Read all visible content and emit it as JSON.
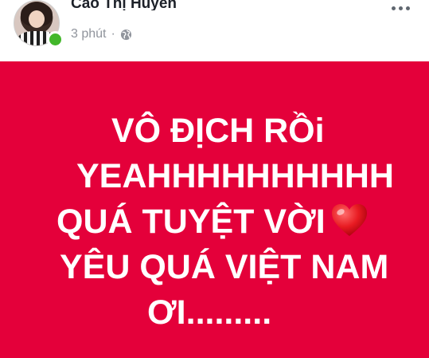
{
  "post": {
    "author": "Cao Thị Huyền",
    "timestamp": "3 phút",
    "separator": "·",
    "privacy_icon": "globe-icon",
    "more_icon": "more-options-icon",
    "online_status_color": "#42b72a"
  },
  "card": {
    "background": "#e4003a",
    "text_color": "#ffffff",
    "lines": [
      "VÔ ĐỊCH RỒi",
      "YEAHHHHHHHHHH",
      "QUÁ TUYỆT VỜI",
      "YÊU QUÁ VIỆT NAM",
      "ƠI........."
    ],
    "emoji": "heart-icon"
  }
}
